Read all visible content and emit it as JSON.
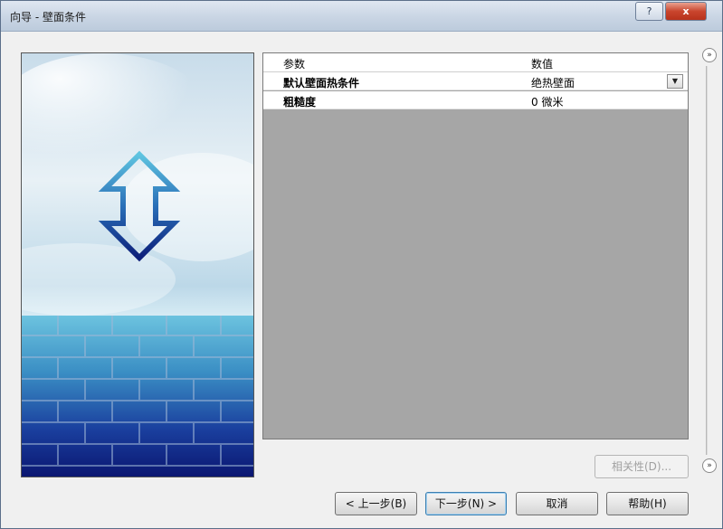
{
  "window": {
    "title": "向导 - 壁面条件"
  },
  "titlebar": {
    "help_label": "?",
    "close_label": "x"
  },
  "grid": {
    "headers": {
      "parameter": "参数",
      "value": "数值"
    },
    "rows": [
      {
        "parameter": "默认壁面热条件",
        "value": "绝热壁面"
      },
      {
        "parameter": "粗糙度",
        "value": "0 微米"
      }
    ]
  },
  "side_buttons": {
    "top": "»",
    "bottom": "»"
  },
  "buttons": {
    "dependency": "相关性(D)...",
    "back": "< 上一步(B)",
    "next": "下一步(N) >",
    "cancel": "取消",
    "help": "帮助(H)"
  },
  "colors": {
    "grid_background": "#a6a6a6",
    "title_gradient": "#c9d5e4",
    "close_button": "#c9452d"
  }
}
